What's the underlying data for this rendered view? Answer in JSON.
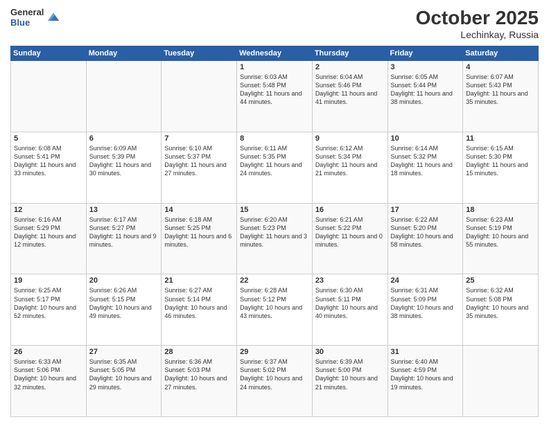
{
  "header": {
    "logo_line1": "General",
    "logo_line2": "Blue",
    "month": "October 2025",
    "location": "Lechinkay, Russia"
  },
  "weekdays": [
    "Sunday",
    "Monday",
    "Tuesday",
    "Wednesday",
    "Thursday",
    "Friday",
    "Saturday"
  ],
  "weeks": [
    [
      {
        "day": "",
        "text": ""
      },
      {
        "day": "",
        "text": ""
      },
      {
        "day": "",
        "text": ""
      },
      {
        "day": "1",
        "text": "Sunrise: 6:03 AM\nSunset: 5:48 PM\nDaylight: 11 hours and 44 minutes."
      },
      {
        "day": "2",
        "text": "Sunrise: 6:04 AM\nSunset: 5:46 PM\nDaylight: 11 hours and 41 minutes."
      },
      {
        "day": "3",
        "text": "Sunrise: 6:05 AM\nSunset: 5:44 PM\nDaylight: 11 hours and 38 minutes."
      },
      {
        "day": "4",
        "text": "Sunrise: 6:07 AM\nSunset: 5:43 PM\nDaylight: 11 hours and 35 minutes."
      }
    ],
    [
      {
        "day": "5",
        "text": "Sunrise: 6:08 AM\nSunset: 5:41 PM\nDaylight: 11 hours and 33 minutes."
      },
      {
        "day": "6",
        "text": "Sunrise: 6:09 AM\nSunset: 5:39 PM\nDaylight: 11 hours and 30 minutes."
      },
      {
        "day": "7",
        "text": "Sunrise: 6:10 AM\nSunset: 5:37 PM\nDaylight: 11 hours and 27 minutes."
      },
      {
        "day": "8",
        "text": "Sunrise: 6:11 AM\nSunset: 5:35 PM\nDaylight: 11 hours and 24 minutes."
      },
      {
        "day": "9",
        "text": "Sunrise: 6:12 AM\nSunset: 5:34 PM\nDaylight: 11 hours and 21 minutes."
      },
      {
        "day": "10",
        "text": "Sunrise: 6:14 AM\nSunset: 5:32 PM\nDaylight: 11 hours and 18 minutes."
      },
      {
        "day": "11",
        "text": "Sunrise: 6:15 AM\nSunset: 5:30 PM\nDaylight: 11 hours and 15 minutes."
      }
    ],
    [
      {
        "day": "12",
        "text": "Sunrise: 6:16 AM\nSunset: 5:29 PM\nDaylight: 11 hours and 12 minutes."
      },
      {
        "day": "13",
        "text": "Sunrise: 6:17 AM\nSunset: 5:27 PM\nDaylight: 11 hours and 9 minutes."
      },
      {
        "day": "14",
        "text": "Sunrise: 6:18 AM\nSunset: 5:25 PM\nDaylight: 11 hours and 6 minutes."
      },
      {
        "day": "15",
        "text": "Sunrise: 6:20 AM\nSunset: 5:23 PM\nDaylight: 11 hours and 3 minutes."
      },
      {
        "day": "16",
        "text": "Sunrise: 6:21 AM\nSunset: 5:22 PM\nDaylight: 11 hours and 0 minutes."
      },
      {
        "day": "17",
        "text": "Sunrise: 6:22 AM\nSunset: 5:20 PM\nDaylight: 10 hours and 58 minutes."
      },
      {
        "day": "18",
        "text": "Sunrise: 6:23 AM\nSunset: 5:19 PM\nDaylight: 10 hours and 55 minutes."
      }
    ],
    [
      {
        "day": "19",
        "text": "Sunrise: 6:25 AM\nSunset: 5:17 PM\nDaylight: 10 hours and 52 minutes."
      },
      {
        "day": "20",
        "text": "Sunrise: 6:26 AM\nSunset: 5:15 PM\nDaylight: 10 hours and 49 minutes."
      },
      {
        "day": "21",
        "text": "Sunrise: 6:27 AM\nSunset: 5:14 PM\nDaylight: 10 hours and 46 minutes."
      },
      {
        "day": "22",
        "text": "Sunrise: 6:28 AM\nSunset: 5:12 PM\nDaylight: 10 hours and 43 minutes."
      },
      {
        "day": "23",
        "text": "Sunrise: 6:30 AM\nSunset: 5:11 PM\nDaylight: 10 hours and 40 minutes."
      },
      {
        "day": "24",
        "text": "Sunrise: 6:31 AM\nSunset: 5:09 PM\nDaylight: 10 hours and 38 minutes."
      },
      {
        "day": "25",
        "text": "Sunrise: 6:32 AM\nSunset: 5:08 PM\nDaylight: 10 hours and 35 minutes."
      }
    ],
    [
      {
        "day": "26",
        "text": "Sunrise: 6:33 AM\nSunset: 5:06 PM\nDaylight: 10 hours and 32 minutes."
      },
      {
        "day": "27",
        "text": "Sunrise: 6:35 AM\nSunset: 5:05 PM\nDaylight: 10 hours and 29 minutes."
      },
      {
        "day": "28",
        "text": "Sunrise: 6:36 AM\nSunset: 5:03 PM\nDaylight: 10 hours and 27 minutes."
      },
      {
        "day": "29",
        "text": "Sunrise: 6:37 AM\nSunset: 5:02 PM\nDaylight: 10 hours and 24 minutes."
      },
      {
        "day": "30",
        "text": "Sunrise: 6:39 AM\nSunset: 5:00 PM\nDaylight: 10 hours and 21 minutes."
      },
      {
        "day": "31",
        "text": "Sunrise: 6:40 AM\nSunset: 4:59 PM\nDaylight: 10 hours and 19 minutes."
      },
      {
        "day": "",
        "text": ""
      }
    ]
  ]
}
